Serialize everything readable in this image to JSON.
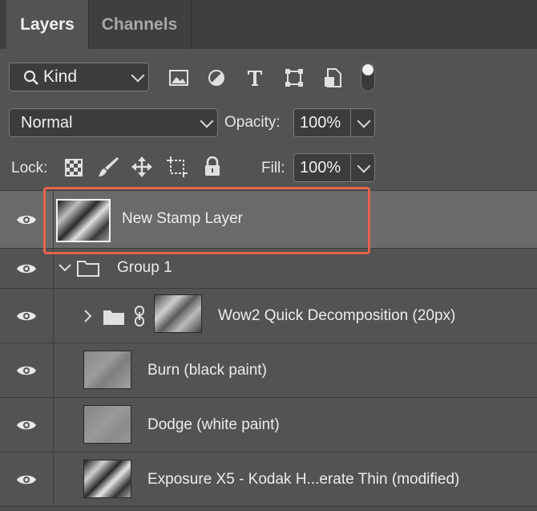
{
  "tabs": [
    {
      "label": "Layers",
      "active": true
    },
    {
      "label": "Channels",
      "active": false
    }
  ],
  "filter": {
    "kind_label": "Kind",
    "icons": [
      "image-filter-icon",
      "adjustment-filter-icon",
      "type-filter-icon",
      "shape-filter-icon",
      "smart-object-filter-icon",
      "filter-toggle-icon"
    ]
  },
  "blend": {
    "mode": "Normal",
    "opacity_label": "Opacity:",
    "opacity_value": "100%"
  },
  "lock": {
    "label": "Lock:",
    "icons": [
      "lock-transparent-pixels-icon",
      "lock-image-pixels-icon",
      "lock-position-icon",
      "lock-artboard-icon",
      "lock-all-icon"
    ],
    "fill_label": "Fill:",
    "fill_value": "100%"
  },
  "layers": [
    {
      "name": "New Stamp Layer",
      "selected": true
    },
    {
      "name": "Group 1",
      "type": "group",
      "expanded": true
    },
    {
      "name": "Wow2 Quick Decomposition (20px)",
      "type": "group",
      "expanded": false
    },
    {
      "name": "Burn (black paint)"
    },
    {
      "name": "Dodge (white paint)"
    },
    {
      "name": "Exposure X5 - Kodak H...erate Thin (modified)"
    }
  ],
  "colors": {
    "panel": "#535353",
    "selected_row": "#6a6a6a",
    "highlight_border": "#e8634b"
  }
}
